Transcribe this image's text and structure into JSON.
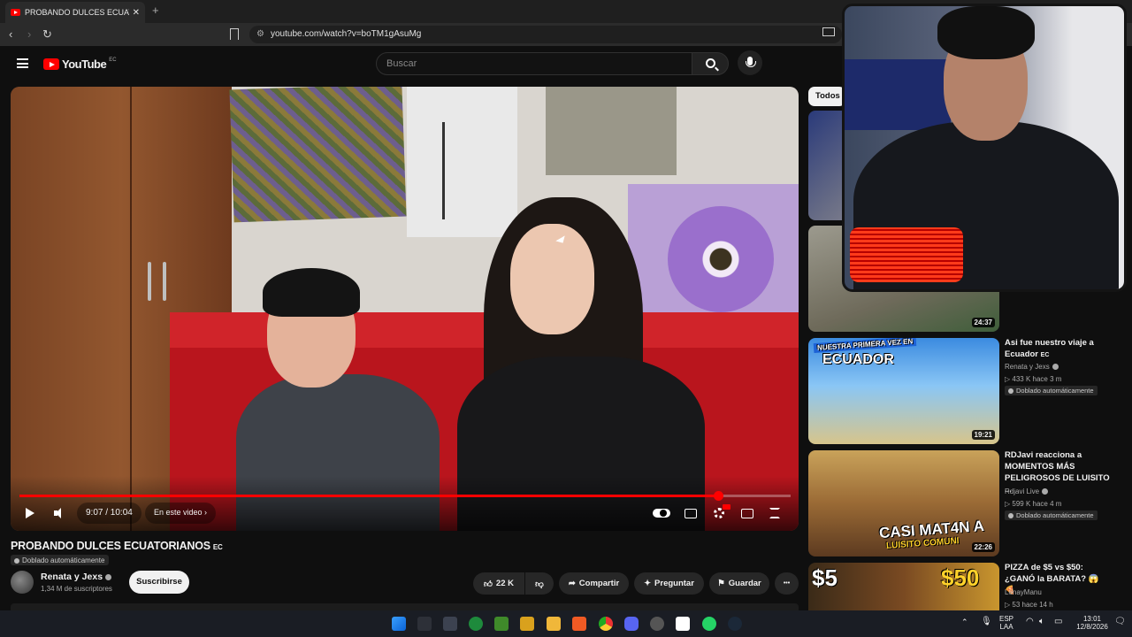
{
  "browser": {
    "tab_title": "PROBANDO DULCES ECUATORIANOS",
    "new_tab": "+",
    "url": "youtube.com/watch?v=boTM1gAsuMg"
  },
  "header": {
    "logo": "YouTube",
    "country": "EC",
    "search_placeholder": "Buscar"
  },
  "player": {
    "time": "9:07 / 10:04",
    "progress_fraction": 0.906,
    "chapter_label": "En este video"
  },
  "video": {
    "title": "PROBANDO DULCES ECUATORIANOS",
    "title_badge": "EC",
    "dubbed": "Doblado automáticamente",
    "channel": "Renata y Jexs",
    "subscribers": "1,34 M de suscriptores",
    "subscribe": "Suscribirse",
    "likes": "22 K",
    "share": "Compartir",
    "ask": "Preguntar",
    "save": "Guardar",
    "more": "•••"
  },
  "sidebar": {
    "chip": "Todos",
    "videos": [
      {
        "duration": "24:37"
      },
      {
        "title": "Asi fue nuestro viaje a Ecuador",
        "badge": "EC",
        "channel": "Renata y Jexs",
        "meta": "▷ 433 K  hace 3 m",
        "dubbed": "Doblado automáticamente",
        "duration": "19:21",
        "thumb_text": "ECUADOR",
        "thumb_banner": "NUESTRA PRIMERA VEZ EN"
      },
      {
        "title": "RDJavi reacciona a MOMENTOS MÁS PELIGROSOS DE LUISITO ...",
        "channel": "Rdjavi Live",
        "meta": "▷ 599 K  hace 4 m",
        "dubbed": "Doblado automáticamente",
        "duration": "22:26",
        "thumb_text": "CASI MAT4N A",
        "thumb_sub": "LUISITO COMUNI"
      },
      {
        "title": "PIZZA de $5 vs $50: ¿GANÓ la BARATA? 😱 🍕",
        "channel": "LenayManu",
        "meta": "▷ 53  hace 14 h",
        "thumb_left": "$5",
        "thumb_right": "$50"
      }
    ]
  },
  "taskbar": {
    "lang_top": "ESP",
    "lang_bottom": "LAA",
    "time": "13:01",
    "date": "12/8/2026"
  },
  "colors": {
    "accent": "#ff0000",
    "background": "#0f0f0f",
    "chip": "#272727"
  }
}
